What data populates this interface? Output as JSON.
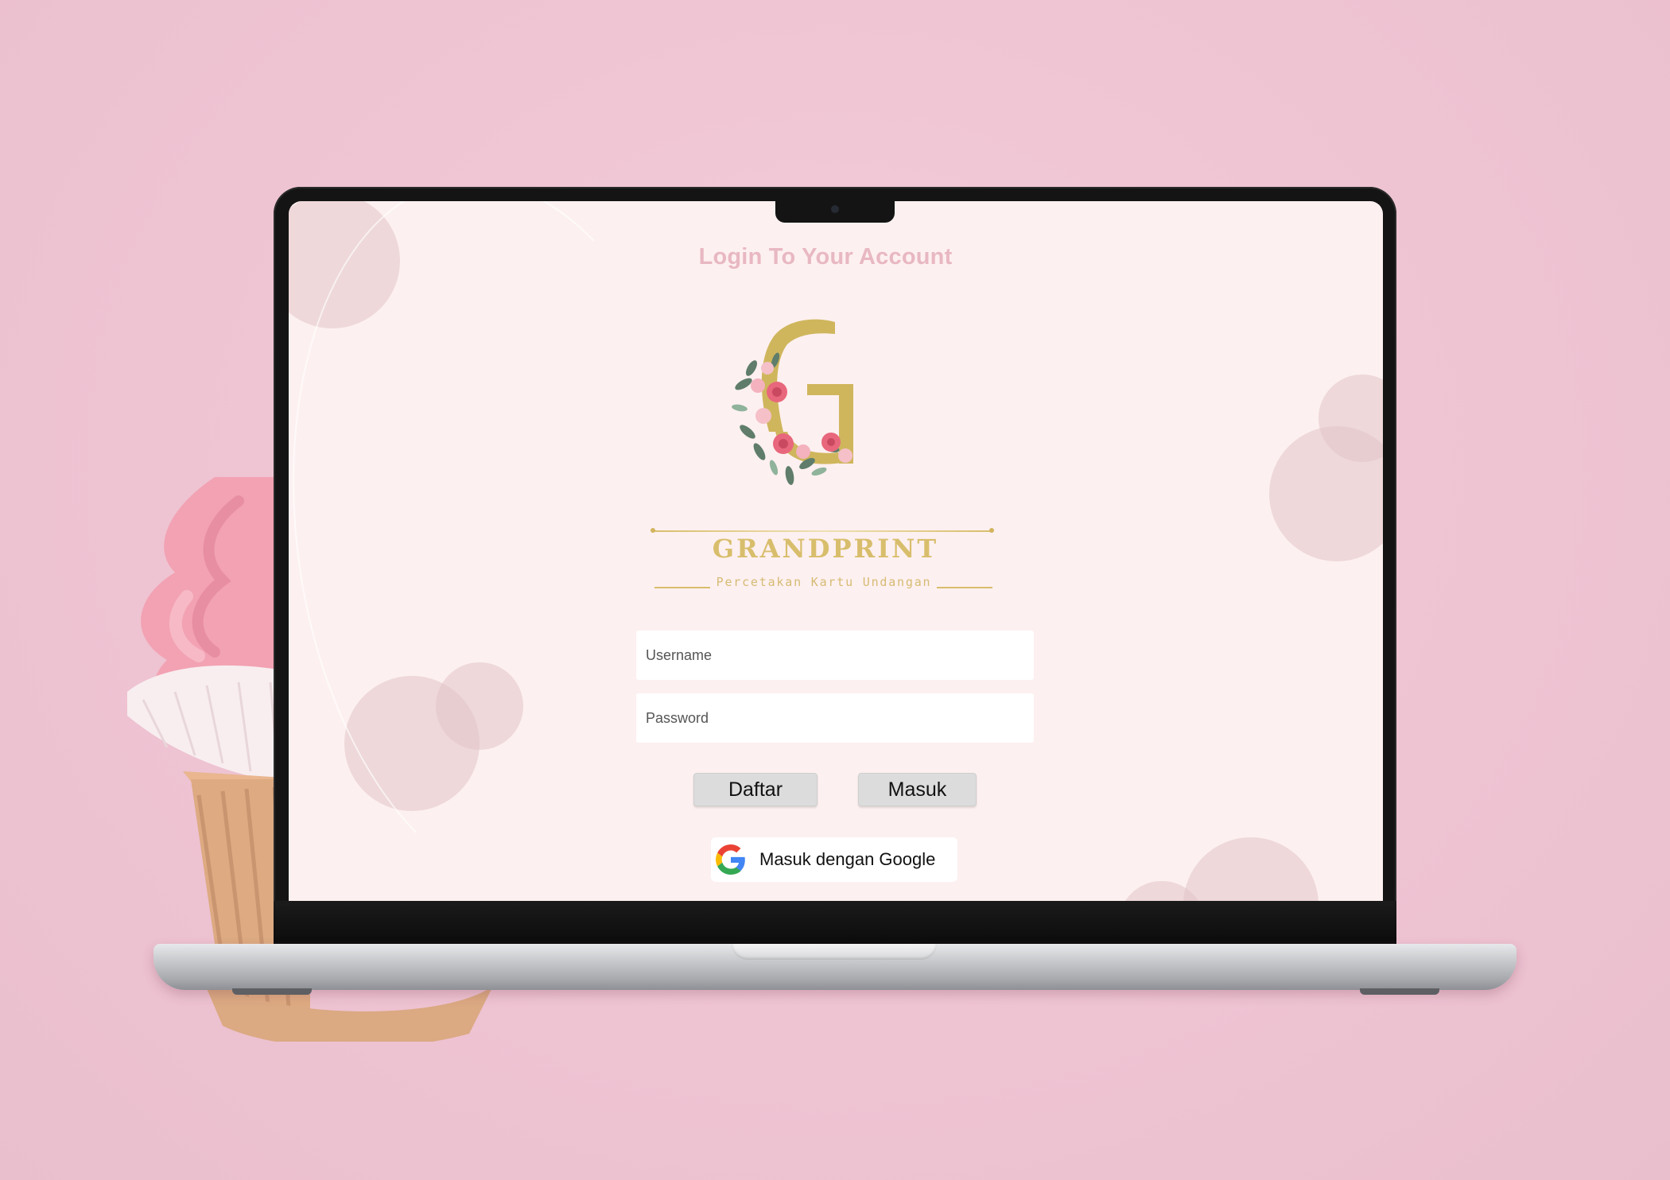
{
  "login": {
    "title": "Login To Your Account",
    "username_placeholder": "Username",
    "password_placeholder": "Password",
    "register_label": "Daftar",
    "login_label": "Masuk",
    "google_label": "Masuk dengan Google"
  },
  "brand": {
    "name": "GRANDPRINT",
    "tagline": "Percetakan Kartu Undangan",
    "logo_letter": "G"
  },
  "icons": {
    "google": "google-g-icon",
    "logo": "floral-g-logo"
  },
  "colors": {
    "background": "#efc8d6",
    "screen": "#fdf0f0",
    "title": "#e8b8c2",
    "gold": "#d8be6c",
    "button": "#dcdcdc"
  }
}
